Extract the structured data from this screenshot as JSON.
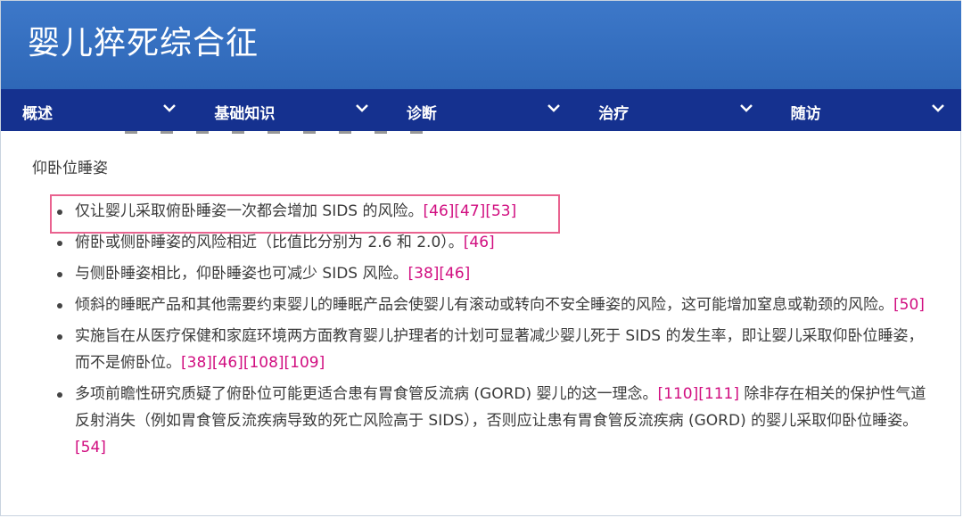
{
  "header": {
    "title": "婴儿猝死综合征"
  },
  "nav": [
    {
      "label": "概述"
    },
    {
      "label": "基础知识"
    },
    {
      "label": "诊断"
    },
    {
      "label": "治疗"
    },
    {
      "label": "随访"
    }
  ],
  "section": {
    "title": "仰卧位睡姿"
  },
  "bullets": [
    {
      "text": "仅让婴儿采取俯卧睡姿一次都会增加 SIDS 的风险。",
      "refs": [
        "[46]",
        "[47]",
        "[53]"
      ]
    },
    {
      "text": "俯卧或侧卧睡姿的风险相近（比值比分别为 2.6 和 2.0）。",
      "refs": [
        "[46]"
      ]
    },
    {
      "text": "与侧卧睡姿相比，仰卧睡姿也可减少 SIDS 风险。",
      "refs": [
        "[38]",
        "[46]"
      ]
    },
    {
      "text": "倾斜的睡眠产品和其他需要约束婴儿的睡眠产品会使婴儿有滚动或转向不安全睡姿的风险，这可能增加窒息或勒颈的风险。",
      "refs": [
        "[50]"
      ]
    },
    {
      "text": "实施旨在从医疗保健和家庭环境两方面教育婴儿护理者的计划可显著减少婴儿死于 SIDS 的发生率，即让婴儿采取仰卧位睡姿，而不是俯卧位。",
      "refs": [
        "[38]",
        "[46]",
        "[108]",
        "[109]"
      ]
    },
    {
      "text": "多项前瞻性研究质疑了俯卧位可能更适合患有胃食管反流病 (GORD) 婴儿的这一理念。",
      "refs": [
        "[110]",
        "[111]"
      ],
      "text2": " 除非存在相关的保护性气道反射消失（例如胃食管反流疾病导致的死亡风险高于 SIDS），否则应让患有胃食管反流疾病 (GORD) 的婴儿采取仰卧位睡姿。",
      "refs2": [
        "[54]"
      ]
    }
  ],
  "colors": {
    "header": "#3d78c9",
    "nav": "#15318f",
    "ref": "#d10e80",
    "highlight": "#e9628f"
  }
}
